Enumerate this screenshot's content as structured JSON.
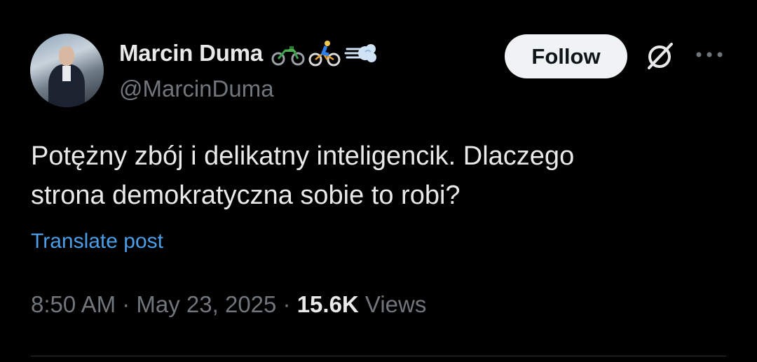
{
  "author": {
    "display_name": "Marcin Duma",
    "handle": "@MarcinDuma",
    "name_emojis": [
      "motorcycle-emoji",
      "cyclist-emoji",
      "dash-emoji"
    ]
  },
  "actions": {
    "follow_label": "Follow",
    "grok_icon": "grok-icon",
    "more_icon": "more-icon"
  },
  "tweet": {
    "line1": "Potężny zbój i delikatny inteligencik. Dlaczego",
    "line2": "strona demokratyczna sobie to robi?",
    "translate_label": "Translate post"
  },
  "meta": {
    "time": "8:50 AM",
    "sep1": " · ",
    "date": "May 23, 2025",
    "sep2": " · ",
    "views_count": "15.6K",
    "views_label": " Views"
  },
  "colors": {
    "background": "#000000",
    "text": "#e7e9ea",
    "muted": "#71767b",
    "link": "#4a9fe7",
    "button_bg": "#eff3f4"
  }
}
